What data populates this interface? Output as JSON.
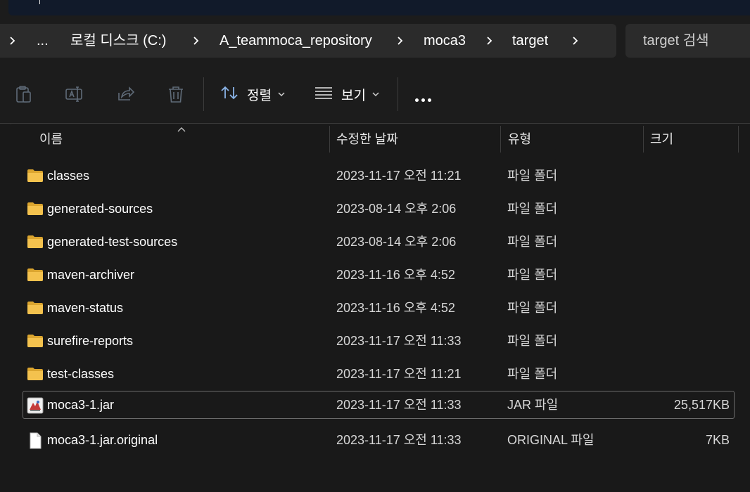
{
  "breadcrumb": {
    "overflow": "...",
    "items": [
      "로컬 디스크 (C:)",
      "A_teammoca_repository",
      "moca3",
      "target"
    ]
  },
  "search": {
    "placeholder": "target 검색"
  },
  "toolbar": {
    "sort_label": "정렬",
    "view_label": "보기",
    "icons": [
      "clipboard-paste-icon",
      "rename-icon",
      "share-icon",
      "trash-icon",
      "sort-arrows-icon",
      "view-lines-icon",
      "more-icon"
    ]
  },
  "columns": {
    "name": "이름",
    "date": "수정한 날짜",
    "type": "유형",
    "size": "크기"
  },
  "files": [
    {
      "name": "classes",
      "date": "2023-11-17 오전 11:21",
      "type": "파일 폴더",
      "size": "",
      "icon": "folder-icon"
    },
    {
      "name": "generated-sources",
      "date": "2023-08-14 오후 2:06",
      "type": "파일 폴더",
      "size": "",
      "icon": "folder-icon"
    },
    {
      "name": "generated-test-sources",
      "date": "2023-08-14 오후 2:06",
      "type": "파일 폴더",
      "size": "",
      "icon": "folder-icon"
    },
    {
      "name": "maven-archiver",
      "date": "2023-11-16 오후 4:52",
      "type": "파일 폴더",
      "size": "",
      "icon": "folder-icon"
    },
    {
      "name": "maven-status",
      "date": "2023-11-16 오후 4:52",
      "type": "파일 폴더",
      "size": "",
      "icon": "folder-icon"
    },
    {
      "name": "surefire-reports",
      "date": "2023-11-17 오전 11:33",
      "type": "파일 폴더",
      "size": "",
      "icon": "folder-icon"
    },
    {
      "name": "test-classes",
      "date": "2023-11-17 오전 11:21",
      "type": "파일 폴더",
      "size": "",
      "icon": "folder-icon"
    },
    {
      "name": "moca3-1.jar",
      "date": "2023-11-17 오전 11:33",
      "type": "JAR 파일",
      "size": "25,517KB",
      "icon": "jar-file-icon",
      "selected": true
    },
    {
      "name": "moca3-1.jar.original",
      "date": "2023-11-17 오전 11:33",
      "type": "ORIGINAL 파일",
      "size": "7KB",
      "icon": "blank-file-icon"
    }
  ],
  "colors": {
    "background": "#191919",
    "toolbar": "#1c1c1c",
    "addressbar": "#2b2b2b",
    "folder": "#f4c24e"
  }
}
